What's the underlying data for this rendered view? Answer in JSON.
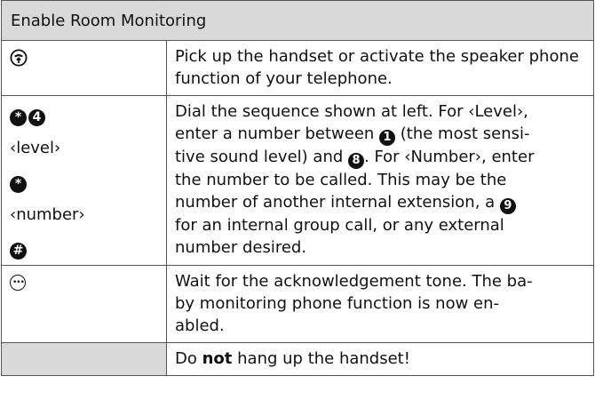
{
  "title": "Enable Room Monitoring",
  "rows": [
    {
      "left_icons": [
        "handset-lift-icon"
      ],
      "text": "Pick up the handset or activate the speaker phone function of your telephone."
    },
    {
      "left_items": [
        {
          "keys": [
            "*",
            "4"
          ]
        },
        {
          "label": "‹level›"
        },
        {
          "keys": [
            "*"
          ]
        },
        {
          "label": "‹number›"
        },
        {
          "keys": [
            "#"
          ]
        }
      ],
      "text_parts": {
        "a": "Dial the sequence shown at left. For ‹Level›,",
        "b": "enter a number between",
        "key1": "1",
        "c": "(the most sensi-",
        "d": "tive sound level) and",
        "key8": "8",
        "e": ". For ‹Number›, enter",
        "f": "the number to be called. This may be the",
        "g": "number of another internal extension, a",
        "key9": "9",
        "h": "for an internal group call, or any external",
        "i": "number desired."
      }
    },
    {
      "left_icons": [
        "tone-icon"
      ],
      "lines": [
        "Wait for the acknowledgement tone. The ba-",
        "by monitoring phone function is now en-",
        "abled."
      ]
    },
    {
      "text_do": "Do",
      "text_not": "not",
      "text_rest": "hang up the handset!"
    }
  ]
}
